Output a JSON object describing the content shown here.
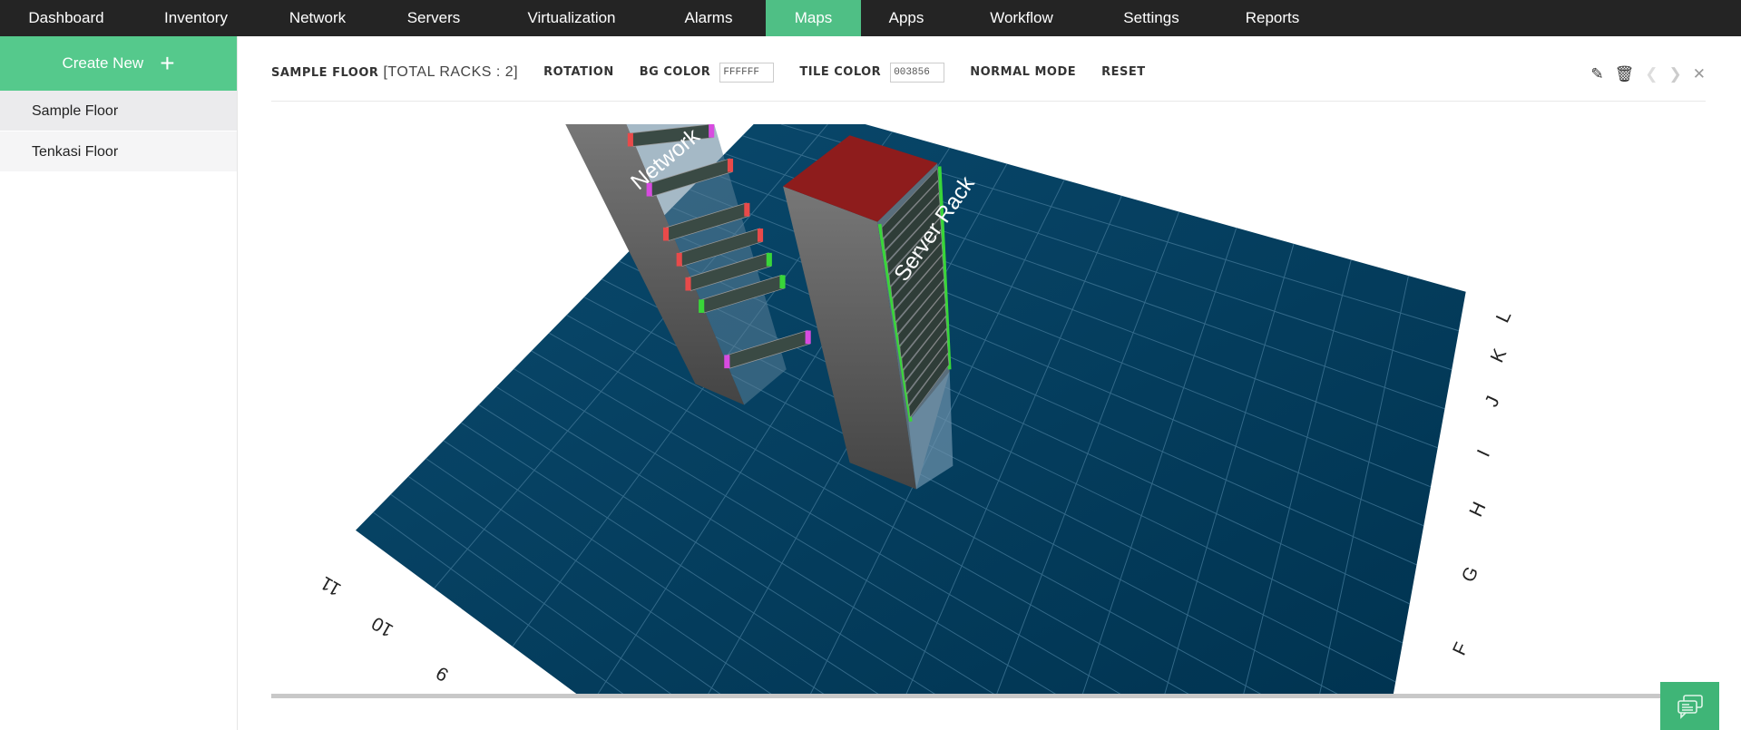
{
  "nav": {
    "items": [
      {
        "label": "Dashboard",
        "width": 146
      },
      {
        "label": "Inventory",
        "width": 140
      },
      {
        "label": "Network",
        "width": 128
      },
      {
        "label": "Servers",
        "width": 128
      },
      {
        "label": "Virtualization",
        "width": 176
      },
      {
        "label": "Alarms",
        "width": 126
      },
      {
        "label": "Maps",
        "width": 105,
        "active": true
      },
      {
        "label": "Apps",
        "width": 100
      },
      {
        "label": "Workflow",
        "width": 154
      },
      {
        "label": "Settings",
        "width": 132
      },
      {
        "label": "Reports",
        "width": 135
      }
    ]
  },
  "sidebar": {
    "create_label": "Create New",
    "items": [
      {
        "label": "Sample Floor",
        "active": true
      },
      {
        "label": "Tenkasi Floor"
      }
    ]
  },
  "toolbar": {
    "floor_name": "SAMPLE FLOOR",
    "total_racks": "[TOTAL RACKS : 2]",
    "rotation": "ROTATION",
    "bg_color_label": "BG COLOR",
    "bg_color": "FFFFFF",
    "tile_color_label": "TILE COLOR",
    "tile_color": "003856",
    "normal_mode": "NORMAL MODE",
    "reset": "RESET"
  },
  "scene": {
    "racks": [
      "Network",
      "Server Rack"
    ],
    "row_labels": [
      "9",
      "10",
      "11"
    ],
    "column_labels": [
      "F",
      "G",
      "H",
      "I",
      "J",
      "K",
      "L"
    ],
    "tile_color": "#003856",
    "bg_color": "#FFFFFF"
  },
  "colors": {
    "accent": "#55c98c",
    "nav_bg": "#242424"
  }
}
